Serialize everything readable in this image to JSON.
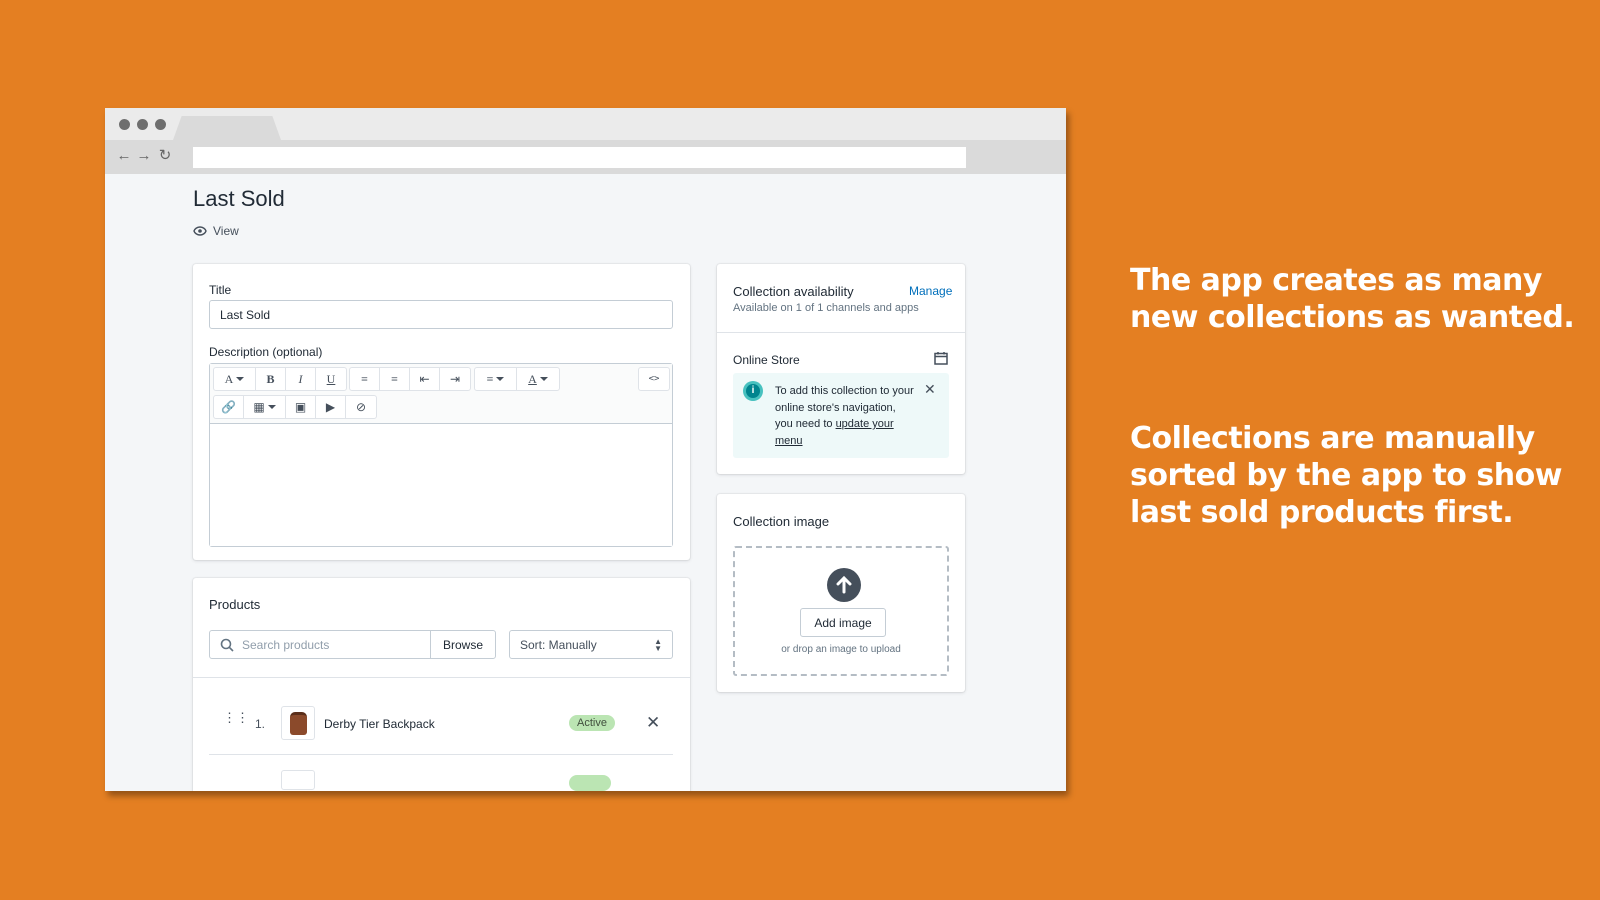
{
  "page": {
    "title": "Last Sold",
    "view_label": "View"
  },
  "title_field": {
    "label": "Title",
    "value": "Last Sold"
  },
  "description": {
    "label": "Description (optional)"
  },
  "products": {
    "heading": "Products",
    "search_placeholder": "Search products",
    "browse_label": "Browse",
    "sort_label": "Sort: Manually",
    "items": [
      {
        "index": "1.",
        "name": "Derby Tier Backpack",
        "status": "Active"
      }
    ]
  },
  "availability": {
    "heading": "Collection availability",
    "manage_label": "Manage",
    "subtext": "Available on 1 of 1 channels and apps",
    "channel": "Online Store",
    "banner_text": "To add this collection to your online store's navigation, you need to",
    "banner_link": "update your menu"
  },
  "image_card": {
    "heading": "Collection image",
    "add_label": "Add image",
    "drop_hint": "or drop an image to upload"
  },
  "captions": [
    "The app creates as many new collections as wanted.",
    "Collections are manually sorted by the app to show last sold products first."
  ],
  "colors": {
    "background": "#E47F22",
    "accent_link": "#006FBB",
    "badge_active": "#BBE5B3",
    "info_icon": "#47C1BF"
  }
}
